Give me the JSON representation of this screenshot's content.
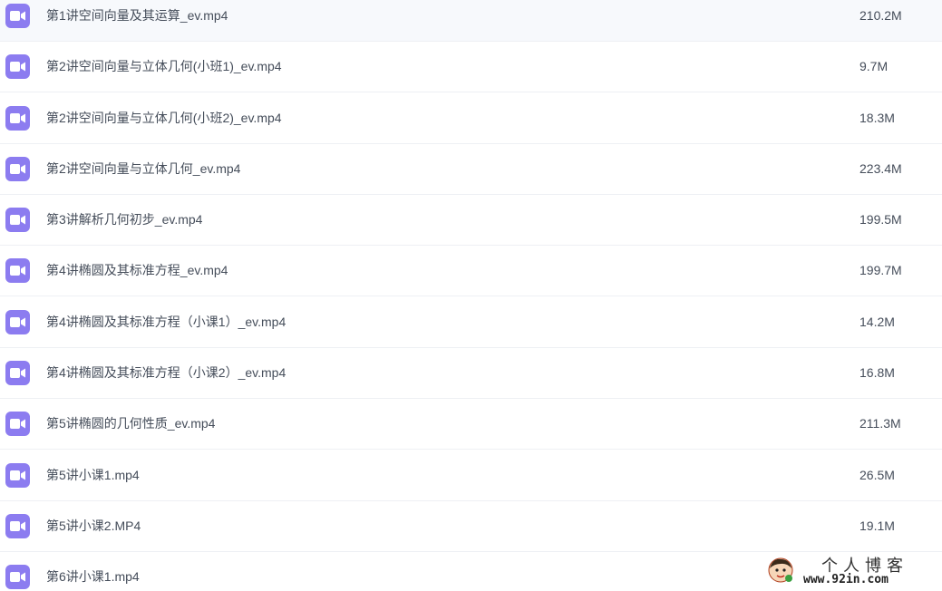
{
  "files": [
    {
      "name": "第1讲空间向量及其运算_ev.mp4",
      "size": "210.2M",
      "icon": "video-file-icon"
    },
    {
      "name": "第2讲空间向量与立体几何(小班1)_ev.mp4",
      "size": "9.7M",
      "icon": "video-file-icon"
    },
    {
      "name": "第2讲空间向量与立体几何(小班2)_ev.mp4",
      "size": "18.3M",
      "icon": "video-file-icon"
    },
    {
      "name": "第2讲空间向量与立体几何_ev.mp4",
      "size": "223.4M",
      "icon": "video-file-icon"
    },
    {
      "name": "第3讲解析几何初步_ev.mp4",
      "size": "199.5M",
      "icon": "video-file-icon"
    },
    {
      "name": "第4讲椭圆及其标准方程_ev.mp4",
      "size": "199.7M",
      "icon": "video-file-icon"
    },
    {
      "name": "第4讲椭圆及其标准方程（小课1）_ev.mp4",
      "size": "14.2M",
      "icon": "video-file-icon"
    },
    {
      "name": "第4讲椭圆及其标准方程（小课2）_ev.mp4",
      "size": "16.8M",
      "icon": "video-file-icon"
    },
    {
      "name": "第5讲椭圆的几何性质_ev.mp4",
      "size": "211.3M",
      "icon": "video-file-icon"
    },
    {
      "name": "第5讲小课1.mp4",
      "size": "26.5M",
      "icon": "video-file-icon"
    },
    {
      "name": "第5讲小课2.MP4",
      "size": "19.1M",
      "icon": "video-file-icon"
    },
    {
      "name": "第6讲小课1.mp4",
      "size": "",
      "icon": "video-file-icon"
    }
  ],
  "watermark": {
    "title": "个人博客",
    "url": "www.92in.com"
  },
  "colors": {
    "icon_bg": "#8c7cf0",
    "text": "#454d5a",
    "divider": "#eef0f4"
  }
}
